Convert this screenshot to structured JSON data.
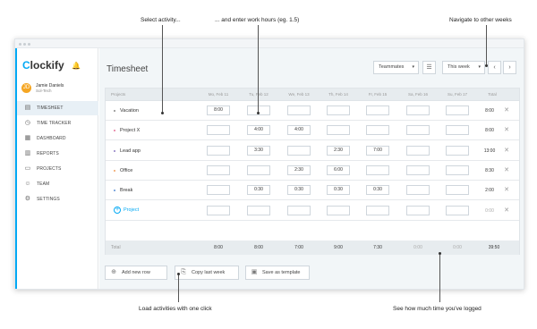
{
  "annotations": {
    "select_activity": "Select activity...",
    "enter_hours": "... and enter work hours (eg. 1.5)",
    "navigate_weeks": "Navigate to other weeks",
    "load_activities": "Load activities with one click",
    "see_time": "See how much time you've logged"
  },
  "brand": {
    "name_prefix": "C",
    "name_rest": "lockify",
    "accent_color": "#03a9f4"
  },
  "user": {
    "name": "Jamie Daniels",
    "org": "Sol-Tech",
    "initials": "JD"
  },
  "nav": [
    {
      "label": "TIMESHEET",
      "icon": "timesheet-icon"
    },
    {
      "label": "TIME TRACKER",
      "icon": "clock-icon"
    },
    {
      "label": "DASHBOARD",
      "icon": "dashboard-icon"
    },
    {
      "label": "REPORTS",
      "icon": "reports-icon"
    },
    {
      "label": "PROJECTS",
      "icon": "folder-icon"
    },
    {
      "label": "TEAM",
      "icon": "team-icon"
    },
    {
      "label": "SETTINGS",
      "icon": "gear-icon"
    }
  ],
  "page_title": "Timesheet",
  "controls": {
    "teammates": "Teammates",
    "week": "This week",
    "prev": "‹",
    "next": "›"
  },
  "columns": [
    "Projects",
    "Mo, Feb 11",
    "Tu, Feb 12",
    "We, Feb 13",
    "Th, Feb 14",
    "Fr, Feb 15",
    "Sa, Feb 16",
    "Su, Feb 17",
    "Total"
  ],
  "rows": [
    {
      "name": "Vacation",
      "color": "#888888",
      "cells": [
        "8:00",
        "",
        "",
        "",
        "",
        "",
        ""
      ],
      "total": "8:00"
    },
    {
      "name": "Project X",
      "color": "#e5739a",
      "cells": [
        "",
        "4:00",
        "4:00",
        "",
        "",
        "",
        ""
      ],
      "total": "8:00"
    },
    {
      "name": "Lead app",
      "color": "#8e7cc3",
      "cells": [
        "",
        "3:30",
        "",
        "2:30",
        "7:00",
        "",
        ""
      ],
      "total": "13:00"
    },
    {
      "name": "Office",
      "color": "#f0a060",
      "cells": [
        "",
        "",
        "2:30",
        "6:00",
        "",
        "",
        ""
      ],
      "total": "8:30"
    },
    {
      "name": "Break",
      "color": "#5b8fd6",
      "cells": [
        "",
        "0:30",
        "0:30",
        "0:30",
        "0:30",
        "",
        ""
      ],
      "total": "2:00"
    }
  ],
  "add_project": {
    "label": "Project",
    "total": "0:00"
  },
  "totals": {
    "label": "Total",
    "values": [
      "8:00",
      "8:00",
      "7:00",
      "9:00",
      "7:30",
      "0:00",
      "0:00"
    ],
    "total": "39:50"
  },
  "actions": {
    "add_row": "Add new row",
    "copy_last": "Copy last week",
    "save_template": "Save as template"
  },
  "close_symbol": "✕"
}
